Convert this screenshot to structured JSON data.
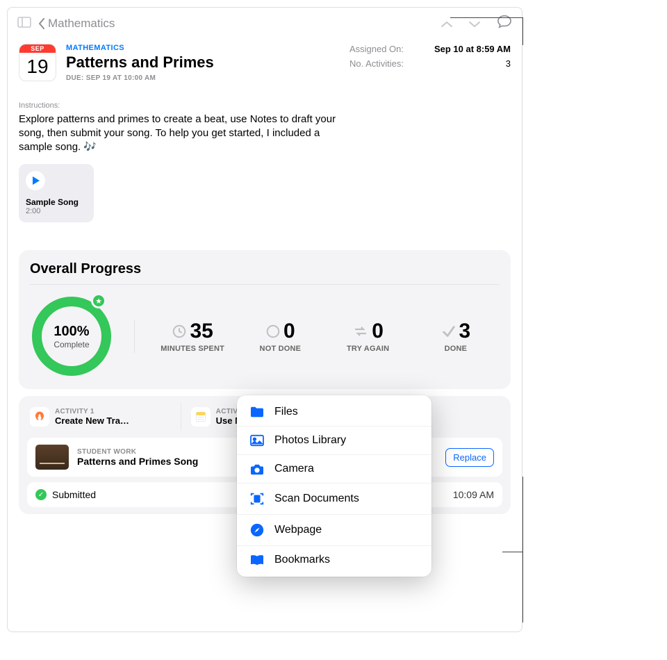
{
  "topbar": {
    "back_label": "Mathematics"
  },
  "header": {
    "subject": "MATHEMATICS",
    "title": "Patterns and Primes",
    "due_label": "DUE: SEP 19 AT 10:00 AM",
    "cal_month": "SEP",
    "cal_day": "19"
  },
  "meta": {
    "assigned_label": "Assigned On:",
    "assigned_value": "Sep 10 at 8:59 AM",
    "activities_label": "No. Activities:",
    "activities_value": "3"
  },
  "instructions": {
    "label": "Instructions:",
    "text": "Explore patterns and primes to create a beat, use Notes to draft your song, then submit your song. To help you get started, I included a sample song. 🎶"
  },
  "attachment": {
    "title": "Sample Song",
    "duration": "2:00"
  },
  "progress": {
    "title": "Overall Progress",
    "percent_text": "100%",
    "percent_sub": "Complete",
    "stats": {
      "minutes": {
        "value": "35",
        "label": "MINUTES SPENT"
      },
      "not_done": {
        "value": "0",
        "label": "NOT DONE"
      },
      "try_again": {
        "value": "0",
        "label": "TRY AGAIN"
      },
      "done": {
        "value": "3",
        "label": "DONE"
      }
    }
  },
  "activities": {
    "a1": {
      "label": "ACTIVITY 1",
      "title": "Create New Tra…"
    },
    "a2": {
      "label": "ACTIVITY 2",
      "title": "Use Notes fo"
    }
  },
  "studentwork": {
    "label": "STUDENT WORK",
    "title": "Patterns and Primes Song",
    "replace": "Replace"
  },
  "submitted": {
    "label": "Submitted",
    "time": "10:09 AM"
  },
  "popover": {
    "files": "Files",
    "photos": "Photos Library",
    "camera": "Camera",
    "scan": "Scan Documents",
    "webpage": "Webpage",
    "bookmarks": "Bookmarks"
  }
}
